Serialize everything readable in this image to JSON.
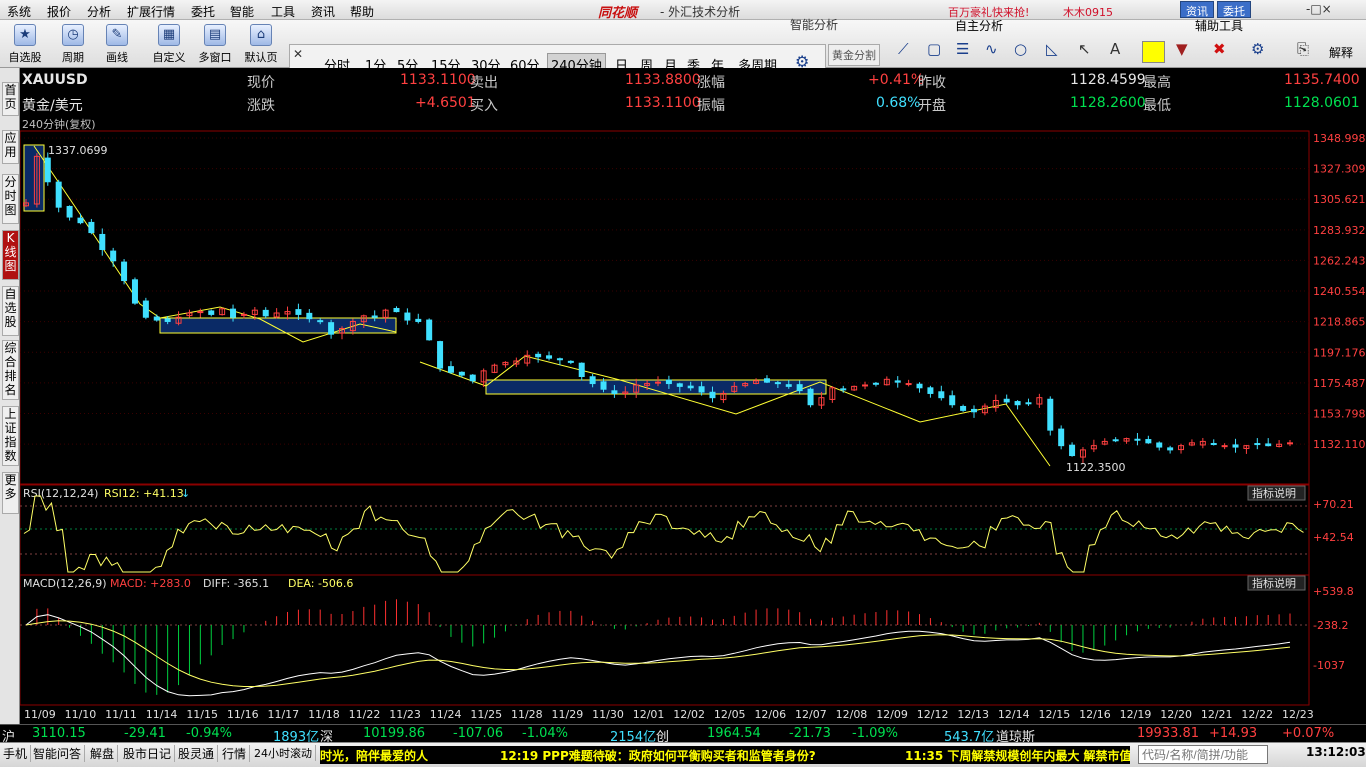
{
  "menu": [
    "系统",
    "报价",
    "分析",
    "扩展行情",
    "委托",
    "智能",
    "工具",
    "资讯",
    "帮助"
  ],
  "brand": "同花顺",
  "window_title": "- 外汇技术分析",
  "ad_text": "百万豪礼快来抢!",
  "username": "木木0915",
  "top_buttons": {
    "news": "资讯",
    "trade": "委托"
  },
  "window_controls": "-□×",
  "toolbar": {
    "self_select": "自选股",
    "period": "周期",
    "draw": "画线",
    "custom": "自定义",
    "multi_window": "多窗口",
    "default": "默认页"
  },
  "periods": [
    "分时",
    "1分",
    "5分",
    "15分",
    "30分",
    "60分",
    "240分钟",
    "日",
    "周",
    "月",
    "季",
    "年",
    "多周期"
  ],
  "selected_period": "240分钟",
  "sections": {
    "smart": "智能分析",
    "self_analysis": "自主分析",
    "aux": "辅助工具",
    "gold_split": "黄金分割",
    "explain": "解释"
  },
  "side_tabs": [
    "首页",
    "应用",
    "分时图",
    "K线图",
    "自选股",
    "综合排名",
    "上证指数",
    "更多"
  ],
  "quote": {
    "symbol": "XAUUSD",
    "name": "黄金/美元",
    "sub": "240分钟(复权)",
    "labels": {
      "now": "现价",
      "change": "涨跌",
      "sell": "卖出",
      "buy": "买入",
      "pct": "涨幅",
      "amp": "振幅",
      "prev_close": "昨收",
      "open": "开盘",
      "high": "最高",
      "low": "最低"
    },
    "now": "1133.1100",
    "change": "+4.6501",
    "sell": "1133.8800",
    "buy": "1133.1100",
    "pct": "+0.41%",
    "amp": "0.68%",
    "prev_close": "1128.4599",
    "open": "1128.2600",
    "high": "1135.7400",
    "low": "1128.0601"
  },
  "chart_data": {
    "type": "candlestick",
    "price_axis": [
      "1348.9985",
      "1327.3095",
      "1305.6210",
      "1283.9325",
      "1262.2435",
      "1240.5540",
      "1218.8655",
      "1197.1765",
      "1175.4870",
      "1153.7985",
      "1132.1100"
    ],
    "ylim": [
      1110,
      1350
    ],
    "annotations": {
      "max": "1337.0699",
      "min": "1122.3500"
    },
    "dates": [
      "11/09",
      "11/10",
      "11/11",
      "11/14",
      "11/15",
      "11/16",
      "11/17",
      "11/18",
      "11/22",
      "11/23",
      "11/24",
      "11/25",
      "11/28",
      "11/29",
      "11/30",
      "12/01",
      "12/02",
      "12/05",
      "12/06",
      "12/07",
      "12/08",
      "12/09",
      "12/12",
      "12/13",
      "12/14",
      "12/15",
      "12/16",
      "12/19",
      "12/20",
      "12/21",
      "12/22",
      "12/23"
    ],
    "closes": [
      1303,
      1336,
      1318,
      1300,
      1293,
      1289,
      1282,
      1270,
      1262,
      1248,
      1232,
      1222,
      1220,
      1219,
      1222,
      1225,
      1226,
      1224,
      1228,
      1222,
      1224,
      1227,
      1223,
      1225,
      1226,
      1224,
      1221,
      1219,
      1210,
      1214,
      1219,
      1223,
      1222,
      1227,
      1226,
      1220,
      1219,
      1206,
      1186,
      1183,
      1181,
      1177,
      1184,
      1188,
      1190,
      1191,
      1195,
      1194,
      1193,
      1192,
      1190,
      1180,
      1175,
      1171,
      1168,
      1169,
      1174,
      1175,
      1176,
      1175,
      1173,
      1172,
      1169,
      1165,
      1168,
      1173,
      1175,
      1177,
      1176,
      1175,
      1173,
      1170,
      1160,
      1165,
      1172,
      1171,
      1173,
      1174,
      1175,
      1178,
      1176,
      1175,
      1172,
      1168,
      1165,
      1160,
      1156,
      1155,
      1159,
      1163,
      1162,
      1160,
      1161,
      1165,
      1142,
      1131,
      1124,
      1128,
      1131,
      1134,
      1135,
      1136,
      1135,
      1133,
      1130,
      1128,
      1131,
      1133,
      1134,
      1132,
      1131,
      1130,
      1131,
      1132,
      1131,
      1132,
      1133
    ],
    "rsi": {
      "label": "RSI(12,12,24)",
      "value_label": "RSI12: +41.13",
      "arrow": "↓",
      "axis": [
        "+70.21",
        "+42.54"
      ]
    },
    "macd": {
      "label": "MACD(12,26,9)",
      "macd": "MACD: +283.0",
      "diff": "DIFF: -365.1",
      "dea": "DEA: -506.6",
      "axis": [
        "+539.8",
        "-238.2",
        "-1037"
      ]
    },
    "indicator_btn": "指标说明"
  },
  "index_bar": [
    {
      "name": "沪",
      "value": "3110.15",
      "chg": "-29.41",
      "pct": "-0.94%",
      "vol": "1893亿"
    },
    {
      "name": "深",
      "value": "10199.86",
      "chg": "-107.06",
      "pct": "-1.04%",
      "vol": "2154亿"
    },
    {
      "name": "创",
      "value": "1964.54",
      "chg": "-21.73",
      "pct": "-1.09%",
      "vol": "543.7亿"
    },
    {
      "name": "道琼斯",
      "value": "19933.81",
      "chg": "+14.93",
      "pct": "+0.07%"
    }
  ],
  "bottom_tabs": [
    "手机",
    "智能问答",
    "解盘",
    "股市日记",
    "股灵通",
    "行情",
    "24小时滚动"
  ],
  "news": [
    "时光，陪伴最爱的人",
    "12:19 PPP难题待破：政府如何平衡购买者和监管者身份?",
    "11:35 下周解禁规模创年内最大 解禁市值"
  ],
  "search_placeholder": "代码/名称/简拼/功能",
  "clock": "13:12:03",
  "badge": "78",
  "colors": {
    "up": "#ff4040",
    "down": "#40e0ff",
    "accent": "#b01010"
  }
}
